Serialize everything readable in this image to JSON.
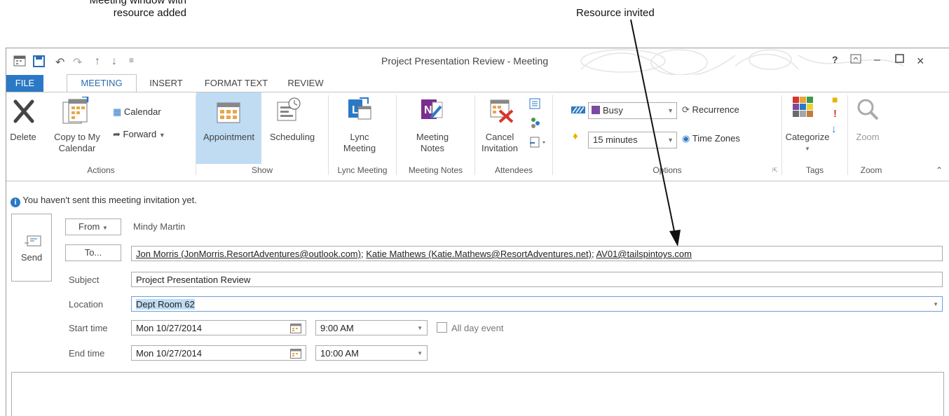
{
  "callouts": {
    "left_line1": "Meeting window with",
    "left_line2": "resource added",
    "right": "Resource invited"
  },
  "window": {
    "title": "Project Presentation Review - Meeting",
    "help": "?"
  },
  "tabs": [
    "FILE",
    "MEETING",
    "INSERT",
    "FORMAT TEXT",
    "REVIEW"
  ],
  "ribbon": {
    "actions": {
      "delete": "Delete",
      "copy1": "Copy to My",
      "copy2": "Calendar",
      "calendar": "Calendar",
      "forward": "Forward",
      "group": "Actions"
    },
    "show": {
      "appointment": "Appointment",
      "scheduling": "Scheduling",
      "group": "Show"
    },
    "lync": {
      "line1": "Lync",
      "line2": "Meeting",
      "group": "Lync Meeting"
    },
    "notes": {
      "line1": "Meeting",
      "line2": "Notes",
      "group": "Meeting Notes"
    },
    "attendees": {
      "line1": "Cancel",
      "line2": "Invitation",
      "group": "Attendees"
    },
    "options": {
      "show_as": "Busy",
      "reminder": "15 minutes",
      "recurrence": "Recurrence",
      "time_zones": "Time Zones",
      "group": "Options"
    },
    "tags": {
      "categorize": "Categorize",
      "group": "Tags"
    },
    "zoom": {
      "label": "Zoom",
      "group": "Zoom"
    }
  },
  "info_bar": "You haven't sent this meeting invitation yet.",
  "form": {
    "send": "Send",
    "from_btn": "From",
    "from_value": "Mindy Martin",
    "to_btn": "To...",
    "to_recipients": [
      "Jon Morris (JonMorris.ResortAdventures@outlook.com)",
      "Katie Mathews (Katie.Mathews@ResortAdventures.net)",
      "AV01@tailspintoys.com"
    ],
    "subject_label": "Subject",
    "subject_value": "Project Presentation Review",
    "location_label": "Location",
    "location_value": "Dept Room 62",
    "start_label": "Start time",
    "start_date": "Mon 10/27/2014",
    "start_time": "9:00 AM",
    "all_day": "All day event",
    "end_label": "End time",
    "end_date": "Mon 10/27/2014",
    "end_time": "10:00 AM"
  }
}
